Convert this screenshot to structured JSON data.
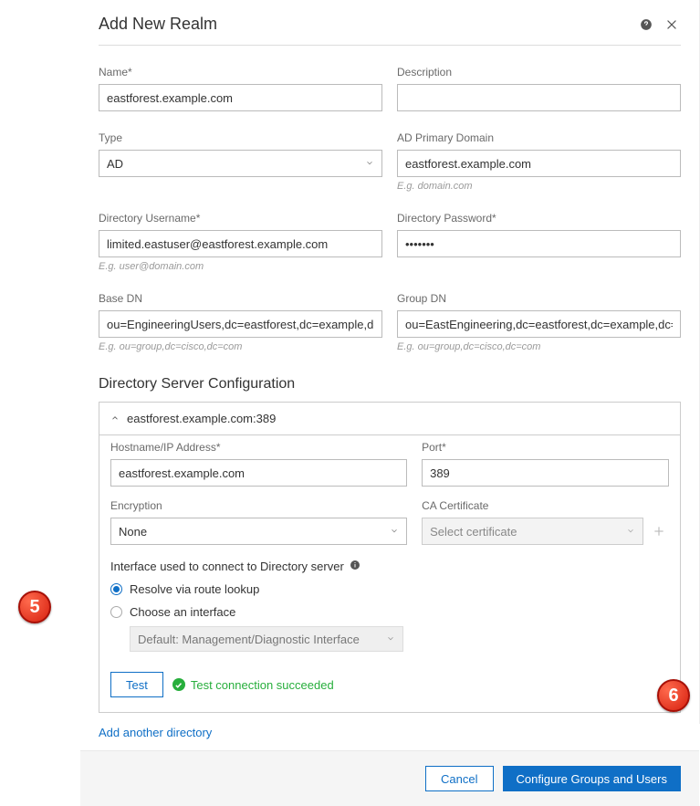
{
  "modal": {
    "title": "Add New Realm",
    "help_icon": "help-circle-icon",
    "close_icon": "close-icon"
  },
  "fields": {
    "name": {
      "label": "Name*",
      "value": "eastforest.example.com"
    },
    "description": {
      "label": "Description",
      "value": ""
    },
    "type": {
      "label": "Type",
      "value": "AD"
    },
    "ad_primary_domain": {
      "label": "AD Primary Domain",
      "value": "eastforest.example.com",
      "hint": "E.g. domain.com"
    },
    "dir_username": {
      "label": "Directory Username*",
      "value": "limited.eastuser@eastforest.example.com",
      "hint": "E.g. user@domain.com"
    },
    "dir_password": {
      "label": "Directory Password*",
      "value": "•••••••"
    },
    "base_dn": {
      "label": "Base DN",
      "value": "ou=EngineeringUsers,dc=eastforest,dc=example,dc=com",
      "hint": "E.g. ou=group,dc=cisco,dc=com"
    },
    "group_dn": {
      "label": "Group DN",
      "value": "ou=EastEngineering,dc=eastforest,dc=example,dc=com",
      "hint": "E.g. ou=group,dc=cisco,dc=com"
    }
  },
  "directory_section": {
    "title": "Directory Server Configuration",
    "panel_title": "eastforest.example.com:389",
    "hostname": {
      "label": "Hostname/IP Address*",
      "value": "eastforest.example.com"
    },
    "port": {
      "label": "Port*",
      "value": "389"
    },
    "encryption": {
      "label": "Encryption",
      "value": "None"
    },
    "ca_cert": {
      "label": "CA Certificate",
      "placeholder": "Select certificate"
    },
    "interface_label": "Interface used to connect to Directory server",
    "radio_resolve": "Resolve via route lookup",
    "radio_choose": "Choose an interface",
    "iface_default": "Default: Management/Diagnostic Interface",
    "test_button": "Test",
    "test_status": "Test connection succeeded",
    "add_another": "Add another directory"
  },
  "footer": {
    "cancel": "Cancel",
    "configure": "Configure Groups and Users"
  },
  "callouts": {
    "five": "5",
    "six": "6"
  }
}
